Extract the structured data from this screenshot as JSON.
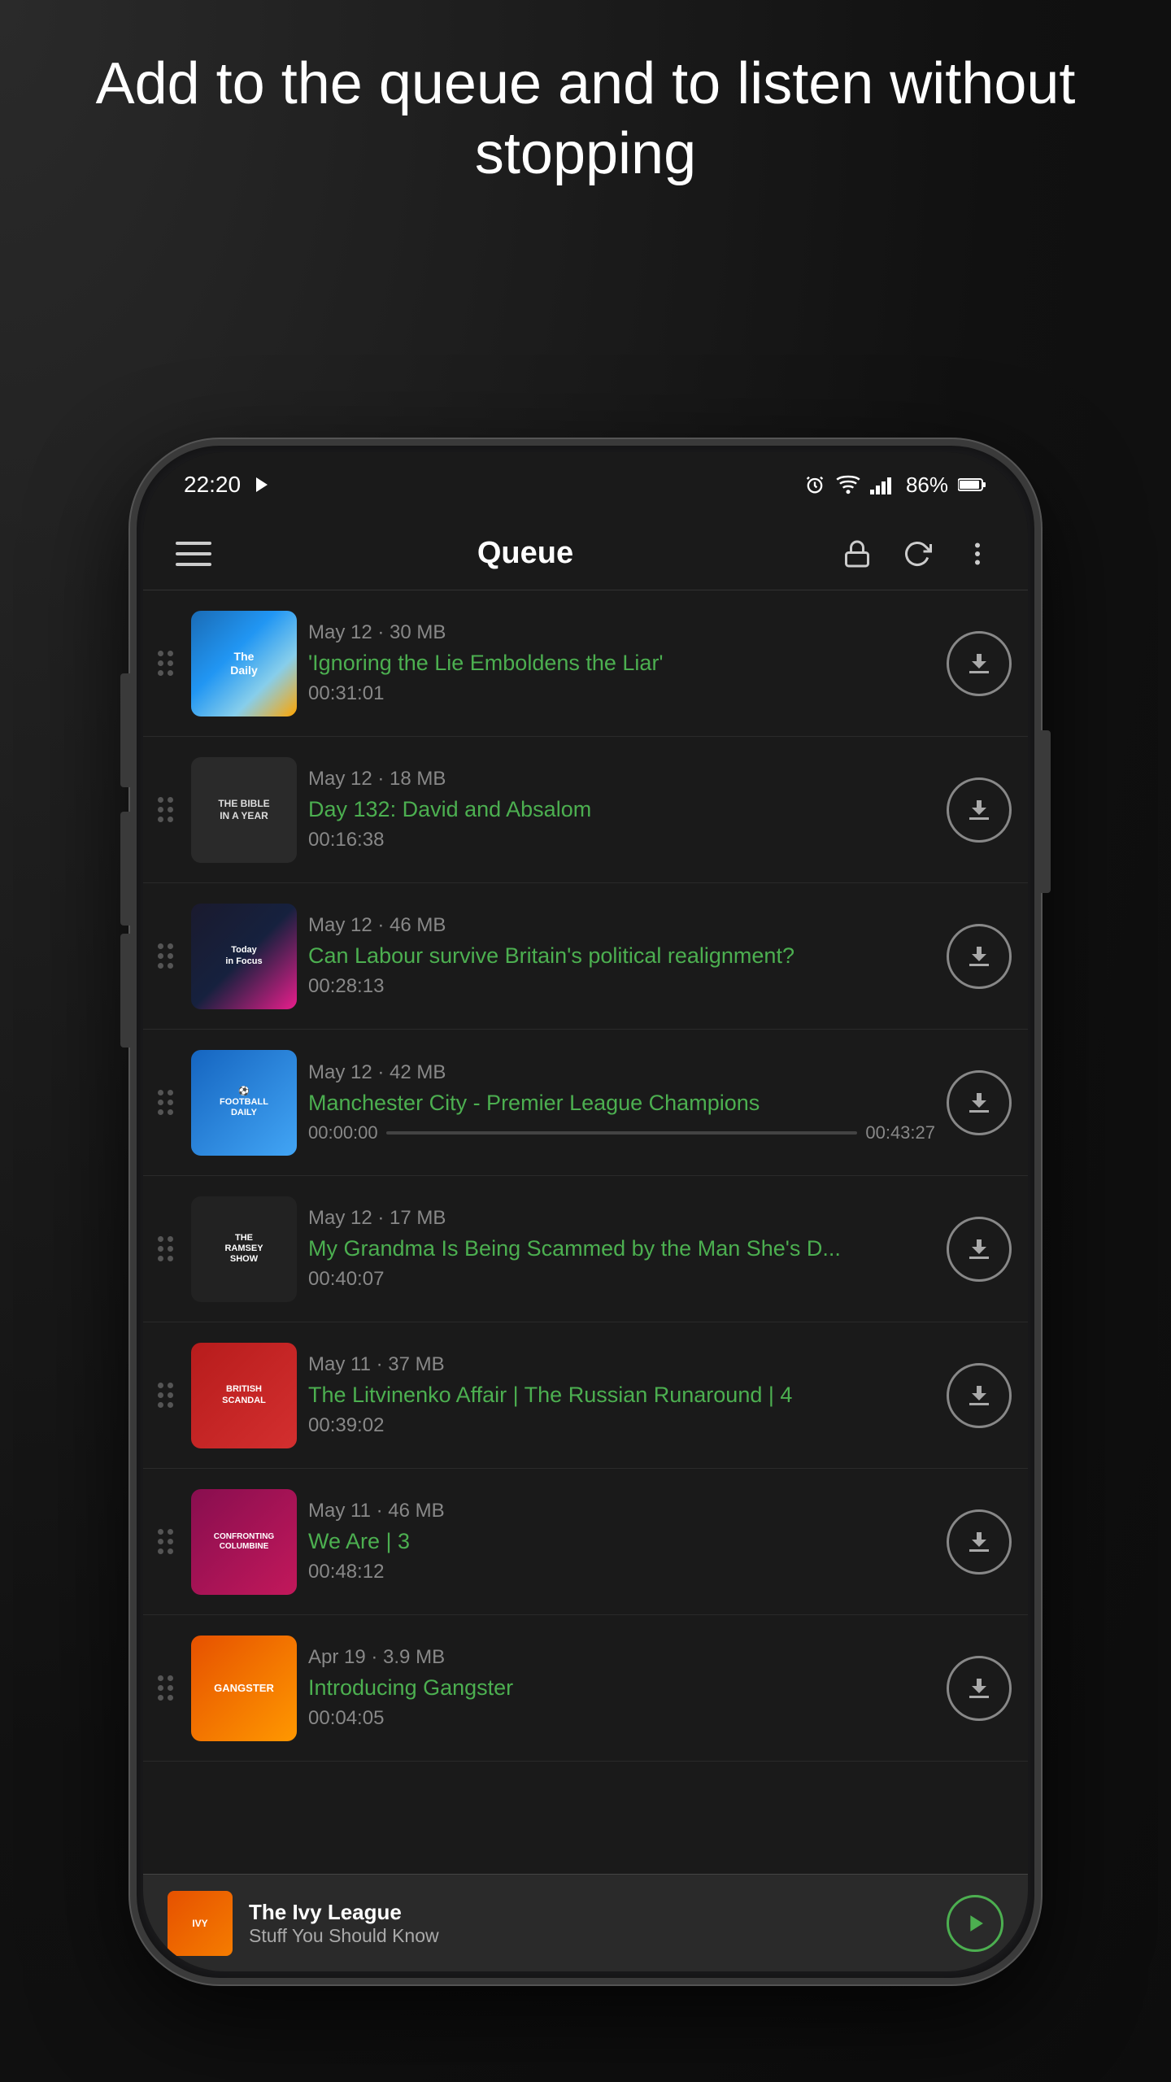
{
  "header": {
    "title": "Add to the queue and to listen without stopping"
  },
  "status_bar": {
    "time": "22:20",
    "battery": "86%",
    "signal_bars": 4
  },
  "app_bar": {
    "title": "Queue",
    "menu_icon": "menu",
    "lock_icon": "lock",
    "refresh_icon": "refresh",
    "more_icon": "more-vertical"
  },
  "queue_items": [
    {
      "id": 1,
      "date": "May 12",
      "size": "30 MB",
      "title": "'Ignoring the Lie Emboldens the Liar'",
      "duration": "00:31:01",
      "podcast": "The Daily",
      "thumb_style": "daily",
      "has_progress": false
    },
    {
      "id": 2,
      "date": "May 12",
      "size": "18 MB",
      "title": "Day 132: David and Absalom",
      "duration": "00:16:38",
      "podcast": "The Bible in a Year",
      "thumb_style": "bible",
      "has_progress": false
    },
    {
      "id": 3,
      "date": "May 12",
      "size": "46 MB",
      "title": "Can Labour survive Britain's political realignment?",
      "duration": "00:28:13",
      "podcast": "Today in Focus",
      "thumb_style": "guardian",
      "has_progress": false
    },
    {
      "id": 4,
      "date": "May 12",
      "size": "42 MB",
      "title": "Manchester City - Premier League Champions",
      "duration": "00:43:27",
      "podcast": "Football Daily",
      "thumb_style": "football",
      "has_progress": true,
      "progress_start": "00:00:00",
      "progress_end": "00:43:27",
      "progress_pct": 0
    },
    {
      "id": 5,
      "date": "May 12",
      "size": "17 MB",
      "title": "My Grandma Is Being Scammed by the Man She's D...",
      "duration": "00:40:07",
      "podcast": "The Ramsey Show",
      "thumb_style": "ramsey",
      "has_progress": false
    },
    {
      "id": 6,
      "date": "May 11",
      "size": "37 MB",
      "title": "The Litvinenko Affair | The Russian Runaround | 4",
      "duration": "00:39:02",
      "podcast": "British Scandal",
      "thumb_style": "british",
      "has_progress": false
    },
    {
      "id": 7,
      "date": "May 11",
      "size": "46 MB",
      "title": "We Are | 3",
      "duration": "00:48:12",
      "podcast": "Confronting Columbine",
      "thumb_style": "columbine",
      "has_progress": false
    },
    {
      "id": 8,
      "date": "Apr 19",
      "size": "3.9 MB",
      "title": "Introducing Gangster",
      "duration": "00:04:05",
      "podcast": "Gangster",
      "thumb_style": "gangster",
      "has_progress": false
    }
  ],
  "now_playing": {
    "title": "The Ivy League",
    "subtitle": "Stuff You Should Know",
    "thumb_style": "ivy"
  },
  "colors": {
    "background": "#1a1a1a",
    "green_accent": "#4CAF50",
    "text_primary": "#ffffff",
    "text_secondary": "#888888",
    "item_border": "#2a2a2a"
  }
}
